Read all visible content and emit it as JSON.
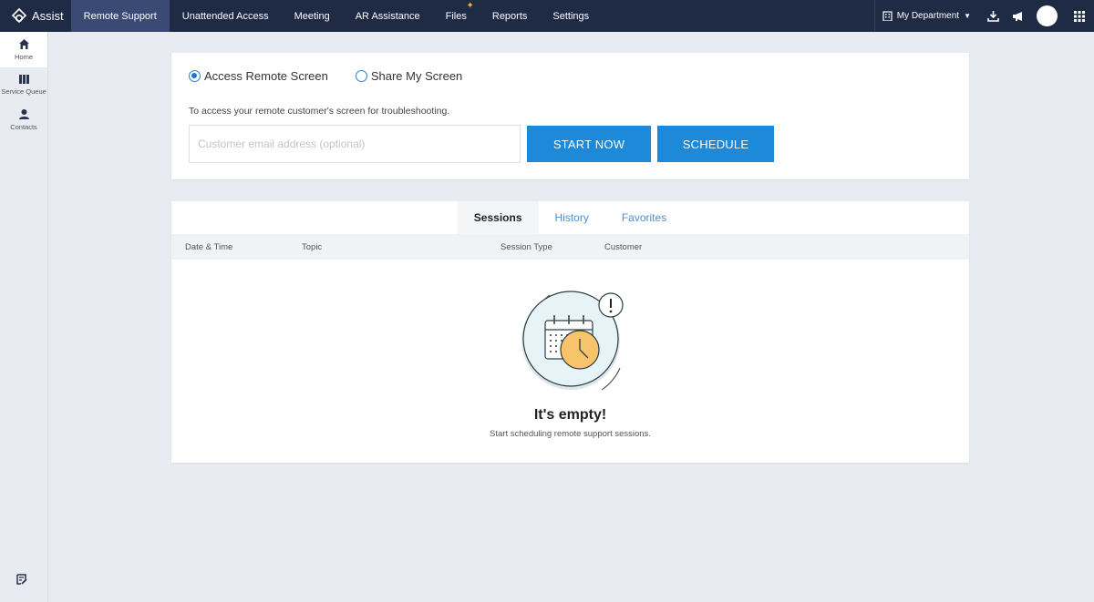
{
  "app": {
    "name": "Assist"
  },
  "nav": {
    "items": [
      {
        "label": "Remote Support",
        "active": true
      },
      {
        "label": "Unattended Access"
      },
      {
        "label": "Meeting"
      },
      {
        "label": "AR Assistance"
      },
      {
        "label": "Files"
      },
      {
        "label": "Reports"
      },
      {
        "label": "Settings"
      }
    ]
  },
  "topright": {
    "department": "My Department"
  },
  "sidebar": {
    "items": [
      {
        "label": "Home",
        "icon": "home-icon",
        "active": true
      },
      {
        "label": "Service Queue",
        "icon": "queue-icon"
      },
      {
        "label": "Contacts",
        "icon": "contacts-icon"
      }
    ]
  },
  "connect": {
    "radio_access": "Access Remote Screen",
    "radio_share": "Share My Screen",
    "selected": "Access Remote Screen",
    "description": "To access your remote customer's screen for troubleshooting.",
    "email_placeholder": "Customer email address (optional)",
    "email_value": "",
    "start_label": "START NOW",
    "schedule_label": "SCHEDULE"
  },
  "sessions": {
    "tabs": [
      "Sessions",
      "History",
      "Favorites"
    ],
    "active_tab": "Sessions",
    "columns": [
      "Date & Time",
      "Topic",
      "Session Type",
      "Customer"
    ],
    "empty_title": "It's empty!",
    "empty_subtitle": "Start scheduling remote support sessions."
  },
  "colors": {
    "topbar": "#1f2a44",
    "active_nav": "#3a4a74",
    "primary": "#1e88d9",
    "link": "#4a8fd4"
  }
}
